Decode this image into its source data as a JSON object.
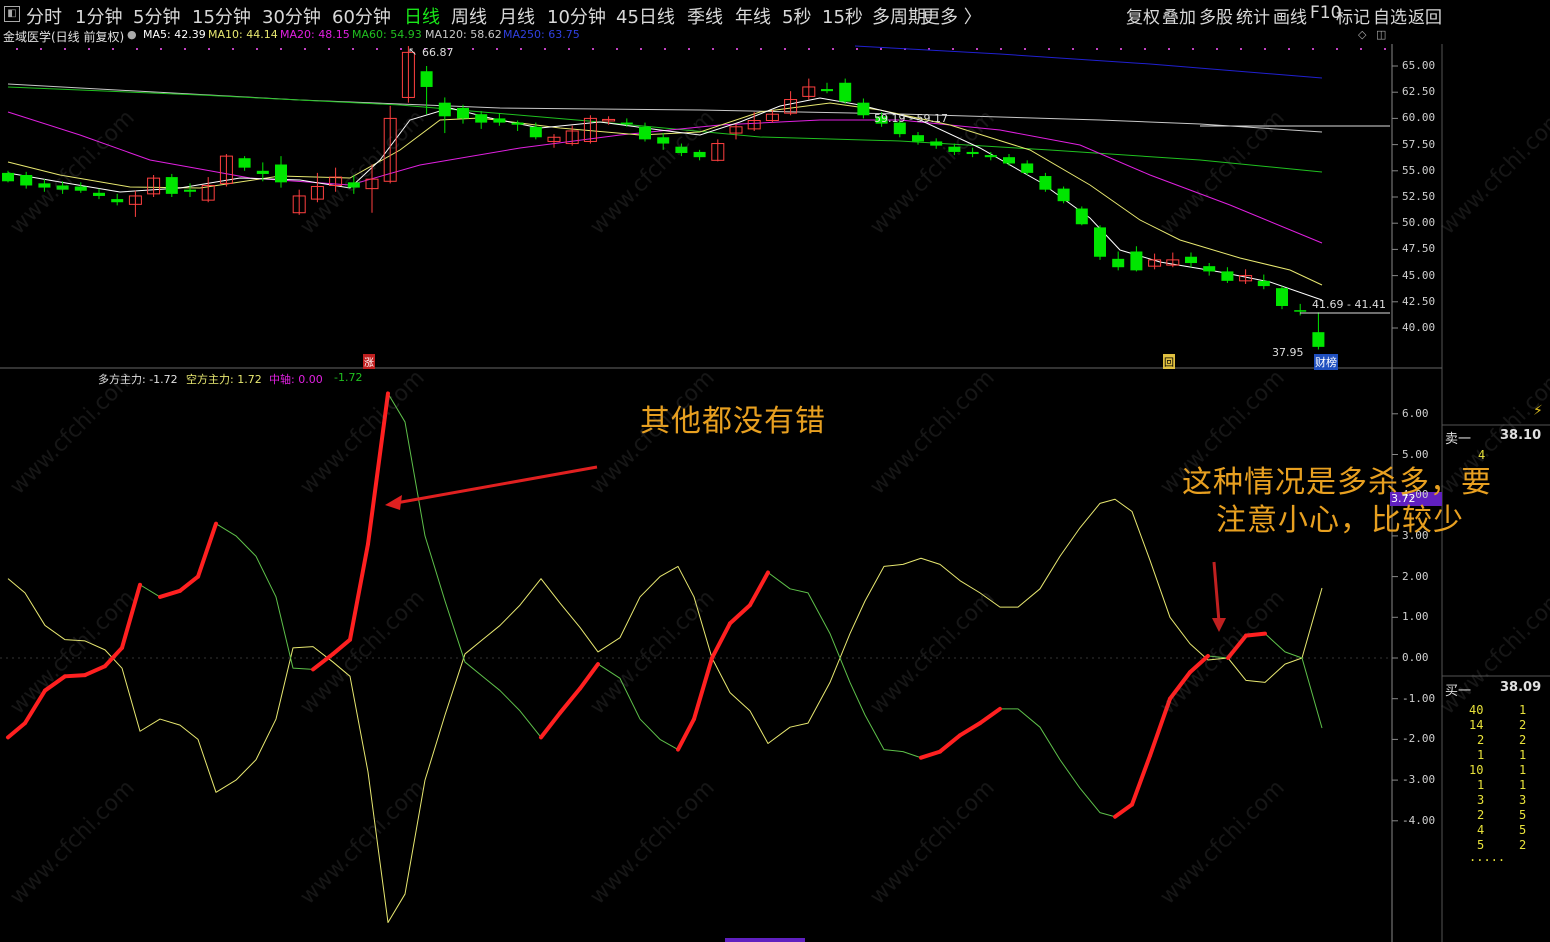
{
  "toolbar": {
    "timeframes": [
      "分时",
      "1分钟",
      "5分钟",
      "15分钟",
      "30分钟",
      "60分钟",
      "日线",
      "周线",
      "月线",
      "10分钟",
      "45日线",
      "季线",
      "年线",
      "5秒",
      "15秒",
      "多周期",
      "更多 〉"
    ],
    "active_timeframe": "日线",
    "right_items": [
      "复权",
      "叠加",
      "多股",
      "统计",
      "画线",
      "F10",
      "标记",
      "自选",
      "返回"
    ]
  },
  "ma_header": {
    "stock": "金域医学(日线 前复权)",
    "ma5": "MA5: 42.39",
    "ma10": "MA10: 44.14",
    "ma20": "MA20: 48.15",
    "ma60": "MA60: 54.93",
    "ma120": "MA120: 58.62",
    "ma250": "MA250: 63.75"
  },
  "price_axis": [
    "65.00",
    "62.50",
    "60.00",
    "57.50",
    "55.00",
    "52.50",
    "50.00",
    "47.50",
    "45.00",
    "42.50",
    "40.00"
  ],
  "price_annotations": {
    "high": "66.87",
    "mid": "59.19 - 59.17",
    "recent": "41.69 - 41.41",
    "low": "37.95"
  },
  "markers": {
    "zhang": "涨",
    "hui": "回",
    "caibang": "财榜"
  },
  "indicator_header": {
    "long": "多方主力: -1.72",
    "short": "空方主力: 1.72",
    "axis": "中轴: 0.00",
    "extra": "-1.72"
  },
  "indicator_axis": [
    "6.00",
    "5.00",
    "4.00",
    "3.00",
    "2.00",
    "1.00",
    "0.00",
    "-1.00",
    "-2.00",
    "-3.00",
    "-4.00"
  ],
  "order_book": {
    "sell_label": "卖一",
    "sell_price": "38.10",
    "sell_qty": "4",
    "highlight": "3.72",
    "buy_label": "买一",
    "buy_price": "38.09",
    "rows": [
      [
        "40",
        "1"
      ],
      [
        "14",
        "2"
      ],
      [
        "2",
        "2"
      ],
      [
        "1",
        "1"
      ],
      [
        "10",
        "1"
      ],
      [
        "1",
        "1"
      ],
      [
        "3",
        "3"
      ],
      [
        "2",
        "5"
      ],
      [
        "4",
        "5"
      ],
      [
        "5",
        "2"
      ]
    ],
    "more": "....."
  },
  "annotations": {
    "note1": "其他都没有错",
    "note2_line1": "这种情况是多杀多，要",
    "note2_line2": "注意小心，比较少"
  },
  "watermark": "www.cfchi.com",
  "colors": {
    "up": "#ff4040",
    "down": "#00e600",
    "ma5": "#ffffff",
    "ma10": "#e8e870",
    "ma20": "#e020e0",
    "ma60": "#20c020",
    "ma120": "#c8c8c8",
    "ma250": "#2020d0",
    "annotation": "#e8a020"
  }
}
